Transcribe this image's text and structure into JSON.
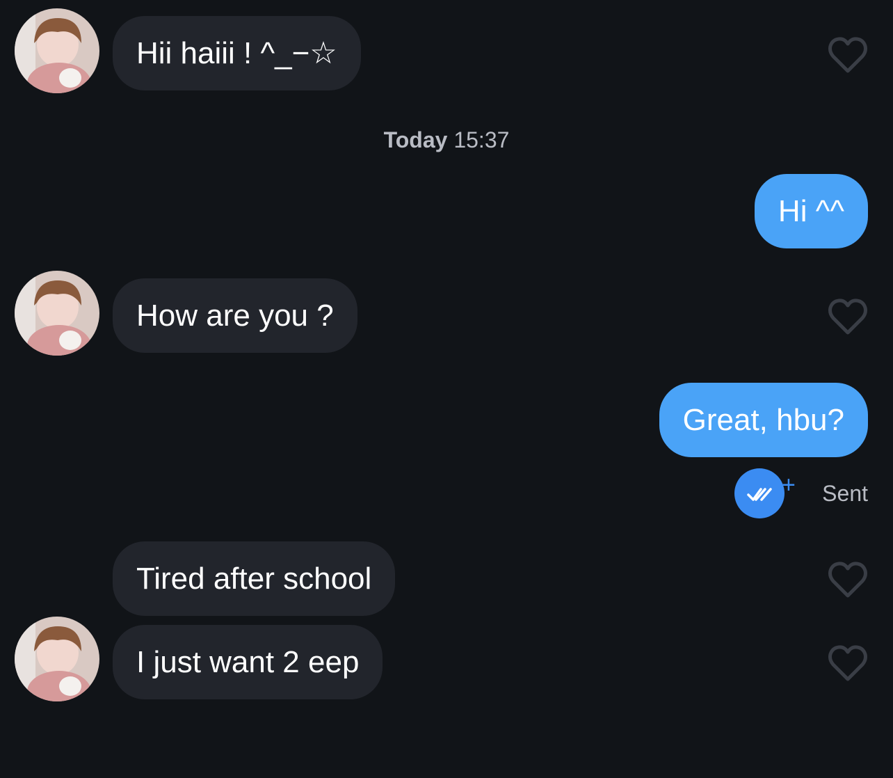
{
  "colors": {
    "background": "#111418",
    "incoming_bubble": "#22252c",
    "outgoing_bubble": "#4aa3f7",
    "seen_badge": "#3b8cf2",
    "muted_text": "#b9bcc4"
  },
  "messages": [
    {
      "direction": "incoming",
      "text": "Hii haiii ! ^_−☆",
      "has_avatar": true,
      "like_icon": "heart-outline-icon"
    },
    {
      "direction": "outgoing",
      "text": "Hi ^^"
    },
    {
      "direction": "incoming",
      "text": "How are you ?",
      "has_avatar": true,
      "like_icon": "heart-outline-icon"
    },
    {
      "direction": "outgoing",
      "text": "Great, hbu?"
    },
    {
      "direction": "incoming",
      "text": "Tired after school",
      "has_avatar": false,
      "like_icon": "heart-outline-icon"
    },
    {
      "direction": "incoming",
      "text": "I just want 2 eep",
      "has_avatar": true,
      "like_icon": "heart-outline-icon"
    }
  ],
  "timestamp": {
    "day": "Today",
    "time": "15:37"
  },
  "status": {
    "icon": "double-check-icon",
    "badge_plus": "+",
    "label": "Sent"
  }
}
